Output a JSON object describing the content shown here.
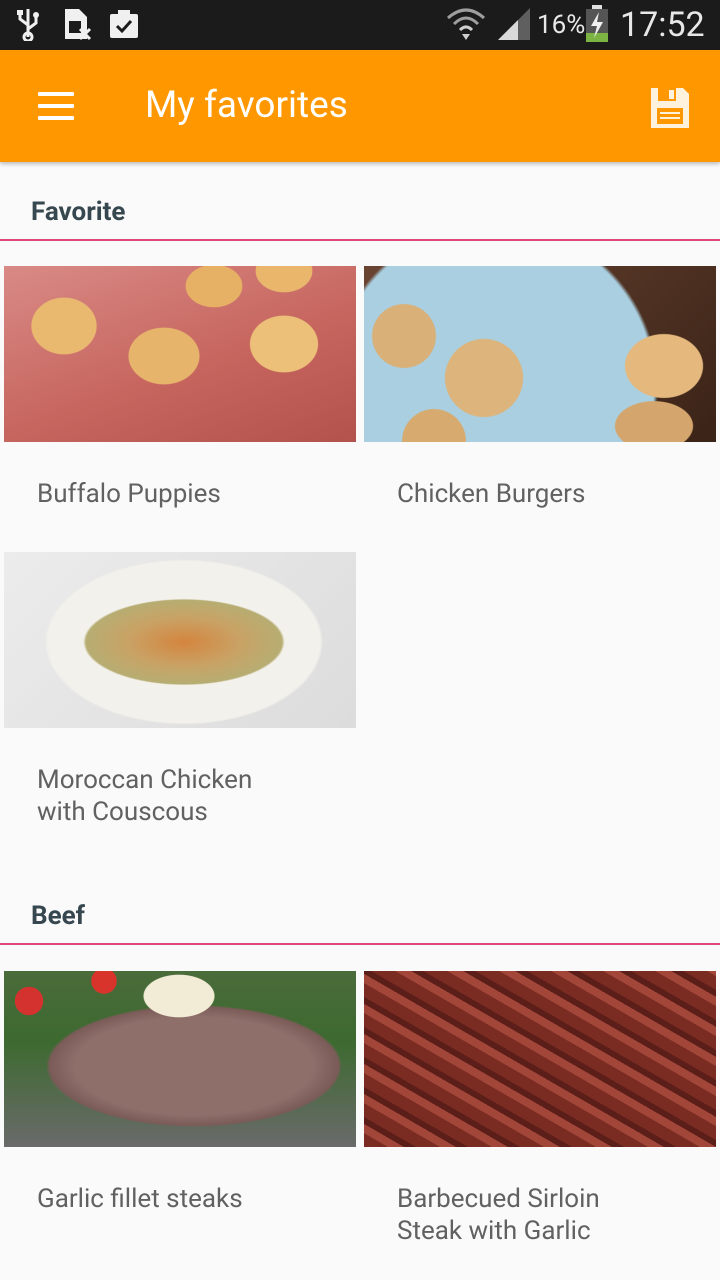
{
  "status_bar": {
    "battery": "16%",
    "time": "17:52"
  },
  "app_bar": {
    "title": "My favorites"
  },
  "sections": [
    {
      "title": "Favorite",
      "items": [
        {
          "label": "Buffalo Puppies"
        },
        {
          "label": "Chicken Burgers"
        },
        {
          "label": "Moroccan Chicken with Couscous"
        }
      ]
    },
    {
      "title": "Beef",
      "items": [
        {
          "label": "Garlic fillet steaks"
        },
        {
          "label": "Barbecued Sirloin Steak with Garlic"
        }
      ]
    }
  ],
  "colors": {
    "app_bar": "#ff9800",
    "section_divider": "#e0457b",
    "section_title": "#37474f",
    "card_label": "#616161"
  }
}
